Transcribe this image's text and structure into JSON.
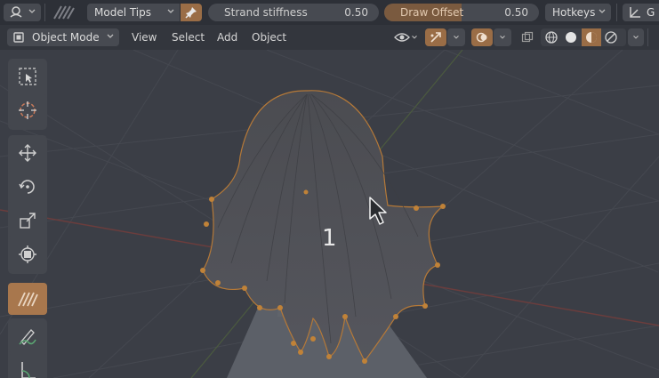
{
  "header": {
    "brush_select": {
      "icon": "hair-brush-icon"
    },
    "falloff_icon": "stripes-icon",
    "mode_dropdown": {
      "value": "Model Tips"
    },
    "pin_icon": "pin-icon",
    "strand_stiffness": {
      "label": "Strand stiffness",
      "value": "0.50",
      "fraction": 0.0
    },
    "draw_offset": {
      "label": "Draw Offset",
      "value": "0.50",
      "fraction": 0.5
    },
    "hotkeys_dropdown": {
      "value": "Hotkeys"
    },
    "cut_label": "G"
  },
  "viewport_header": {
    "object_mode": {
      "value": "Object Mode"
    },
    "menus": [
      "View",
      "Select",
      "Add",
      "Object"
    ]
  },
  "toolbar": {
    "tools": [
      "select-box-icon",
      "cursor-icon",
      "move-icon",
      "rotate-icon",
      "scale-icon",
      "transform-icon",
      "hair-comb-icon",
      "annotate-icon",
      "measure-icon"
    ],
    "active_tool": "hair-comb-icon"
  },
  "viewport": {
    "strand_count_label": "1",
    "accent_color": "#d4853a",
    "background_color": "#3b3e46"
  }
}
